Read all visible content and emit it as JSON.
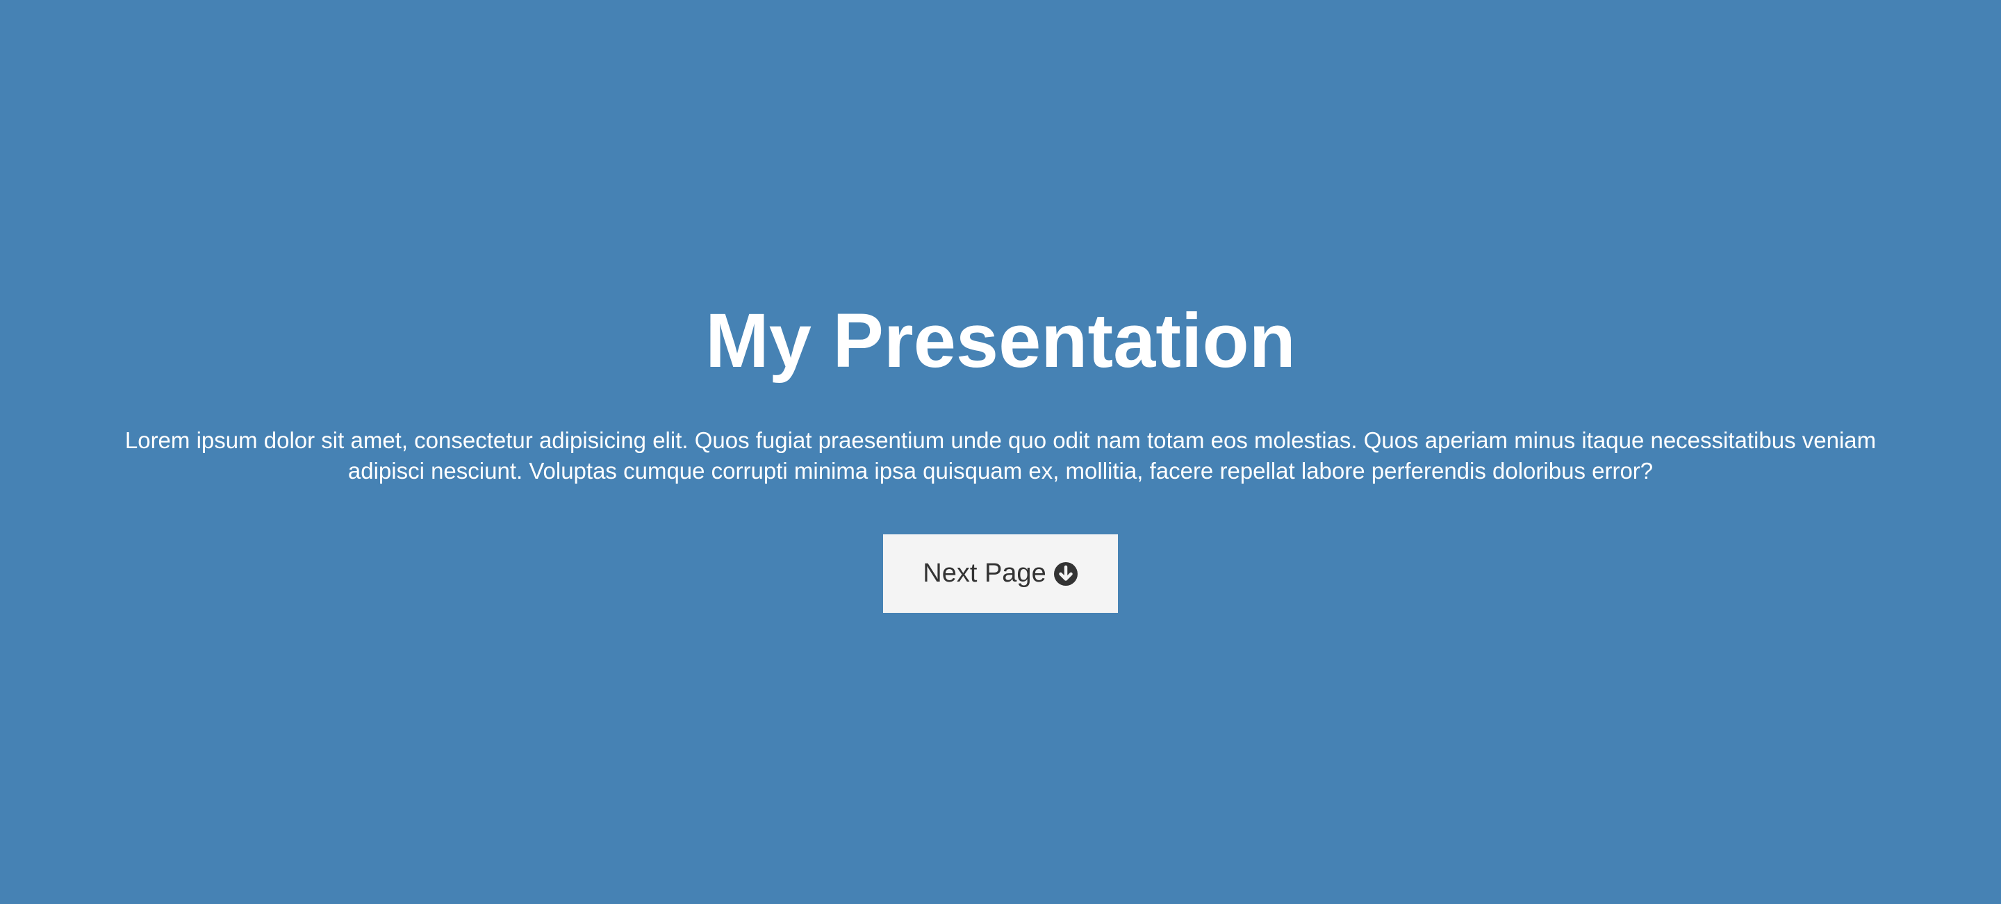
{
  "hero": {
    "title": "My Presentation",
    "description": "Lorem ipsum dolor sit amet, consectetur adipisicing elit. Quos fugiat praesentium unde quo odit nam totam eos molestias. Quos aperiam minus itaque necessitatibus veniam adipisci nesciunt. Voluptas cumque corrupti minima ipsa quisquam ex, mollitia, facere repellat labore perferendis doloribus error?",
    "next_button": {
      "label": "Next Page",
      "icon": "arrow-circle-down-icon"
    }
  },
  "colors": {
    "background": "#4682b4",
    "text": "#ffffff",
    "button_bg": "#f4f4f4",
    "button_text": "#333333"
  }
}
